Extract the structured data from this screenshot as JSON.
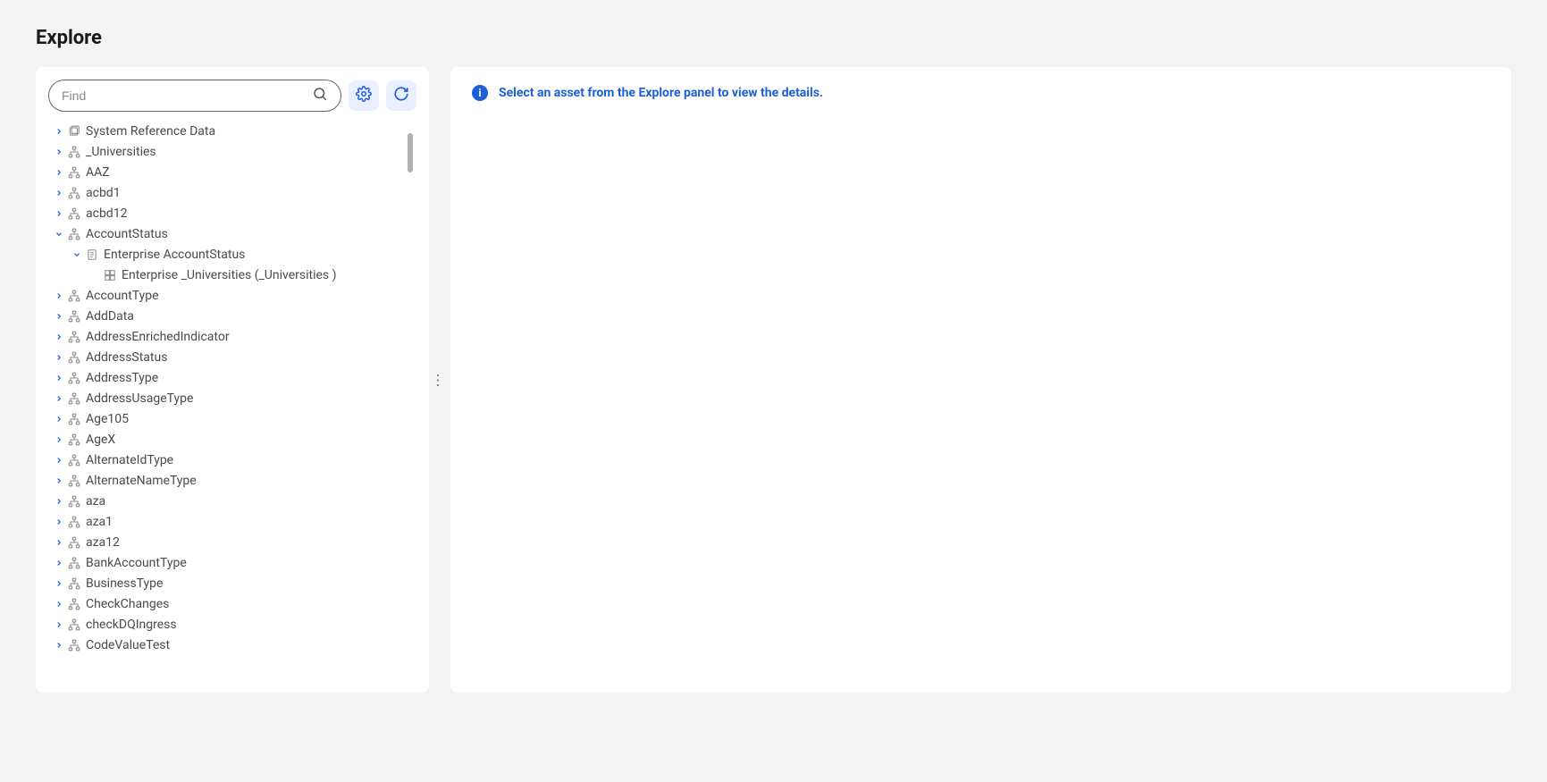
{
  "page": {
    "title": "Explore"
  },
  "search": {
    "placeholder": "Find"
  },
  "info_banner": "Select an asset from the Explore panel to view the details.",
  "tree": [
    {
      "label": "System Reference Data",
      "icon": "folder",
      "level": 0,
      "expand": "right"
    },
    {
      "label": "_Universities",
      "icon": "hier",
      "level": 0,
      "expand": "right"
    },
    {
      "label": "AAZ",
      "icon": "hier",
      "level": 0,
      "expand": "right"
    },
    {
      "label": "acbd1",
      "icon": "hier",
      "level": 0,
      "expand": "right"
    },
    {
      "label": "acbd12",
      "icon": "hier",
      "level": 0,
      "expand": "right"
    },
    {
      "label": "AccountStatus",
      "icon": "hier",
      "level": 0,
      "expand": "down"
    },
    {
      "label": "Enterprise AccountStatus",
      "icon": "doc",
      "level": 1,
      "expand": "down"
    },
    {
      "label": "Enterprise _Universities (_Universities )",
      "icon": "grid",
      "level": 2,
      "expand": "none"
    },
    {
      "label": "AccountType",
      "icon": "hier",
      "level": 0,
      "expand": "right"
    },
    {
      "label": "AddData",
      "icon": "hier",
      "level": 0,
      "expand": "right"
    },
    {
      "label": "AddressEnrichedIndicator",
      "icon": "hier",
      "level": 0,
      "expand": "right"
    },
    {
      "label": "AddressStatus",
      "icon": "hier",
      "level": 0,
      "expand": "right"
    },
    {
      "label": "AddressType",
      "icon": "hier",
      "level": 0,
      "expand": "right"
    },
    {
      "label": "AddressUsageType",
      "icon": "hier",
      "level": 0,
      "expand": "right"
    },
    {
      "label": "Age105",
      "icon": "hier",
      "level": 0,
      "expand": "right"
    },
    {
      "label": "AgeX",
      "icon": "hier",
      "level": 0,
      "expand": "right"
    },
    {
      "label": "AlternateIdType",
      "icon": "hier",
      "level": 0,
      "expand": "right"
    },
    {
      "label": "AlternateNameType",
      "icon": "hier",
      "level": 0,
      "expand": "right"
    },
    {
      "label": "aza",
      "icon": "hier",
      "level": 0,
      "expand": "right"
    },
    {
      "label": "aza1",
      "icon": "hier",
      "level": 0,
      "expand": "right"
    },
    {
      "label": "aza12",
      "icon": "hier",
      "level": 0,
      "expand": "right"
    },
    {
      "label": "BankAccountType",
      "icon": "hier",
      "level": 0,
      "expand": "right"
    },
    {
      "label": "BusinessType",
      "icon": "hier",
      "level": 0,
      "expand": "right"
    },
    {
      "label": "CheckChanges",
      "icon": "hier",
      "level": 0,
      "expand": "right"
    },
    {
      "label": "checkDQIngress",
      "icon": "hier",
      "level": 0,
      "expand": "right"
    },
    {
      "label": "CodeValueTest",
      "icon": "hier",
      "level": 0,
      "expand": "right"
    }
  ]
}
